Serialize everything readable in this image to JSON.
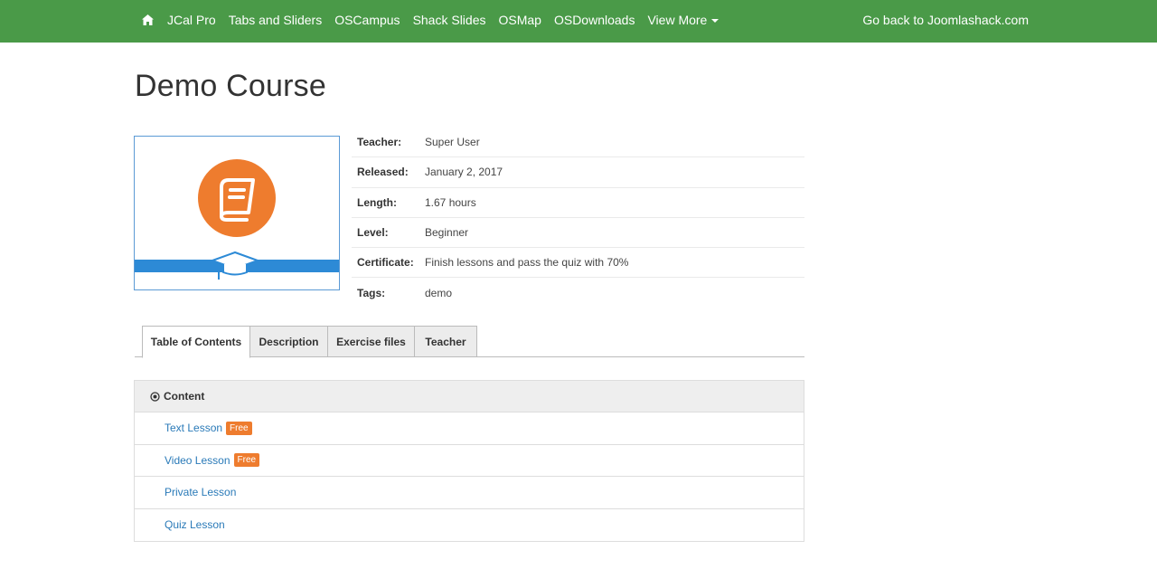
{
  "nav": {
    "home_icon": "home-icon",
    "items": [
      "JCal Pro",
      "Tabs and Sliders",
      "OSCampus",
      "Shack Slides",
      "OSMap",
      "OSDownloads",
      "View More"
    ],
    "back_link": "Go back to Joomlashack.com"
  },
  "page": {
    "title": "Demo Course"
  },
  "course": {
    "image_icon": "book-graduation-cap-icon",
    "info": [
      {
        "label": "Teacher:",
        "value": "Super User"
      },
      {
        "label": "Released:",
        "value": "January 2, 2017"
      },
      {
        "label": "Length:",
        "value": "1.67 hours"
      },
      {
        "label": "Level:",
        "value": "Beginner"
      },
      {
        "label": "Certificate:",
        "value": "Finish lessons and pass the quiz with 70%"
      },
      {
        "label": "Tags:",
        "value": "demo"
      }
    ]
  },
  "tabs": [
    "Table of Contents",
    "Description",
    "Exercise files",
    "Teacher"
  ],
  "active_tab": "Table of Contents",
  "contents": {
    "header": "Content",
    "lessons": [
      {
        "title": "Text Lesson",
        "badge": "Free"
      },
      {
        "title": "Video Lesson",
        "badge": "Free"
      },
      {
        "title": "Private Lesson"
      },
      {
        "title": "Quiz Lesson"
      }
    ]
  },
  "colors": {
    "nav_bg": "#4a9a48",
    "accent_orange": "#ee7c2e",
    "image_blue": "#2d8ad6",
    "link": "#2a7ab8"
  }
}
